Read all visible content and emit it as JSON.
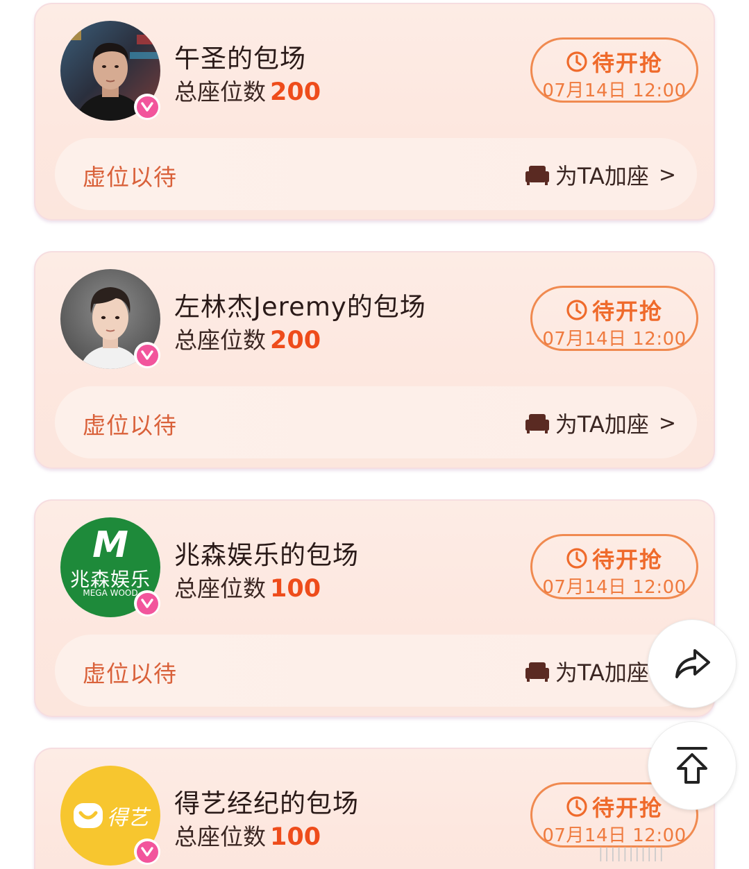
{
  "seat_label": "总座位数",
  "cards": [
    {
      "title": "午圣的包场",
      "seats": "200",
      "status": "待开抢",
      "time": "07月14日 12:00",
      "bar_text": "虚位以待",
      "add_seat": "为TA加座",
      "chevron": ">",
      "avatar_icon": "person-photo-icon"
    },
    {
      "title": "左林杰Jeremy的包场",
      "seats": "200",
      "status": "待开抢",
      "time": "07月14日 12:00",
      "bar_text": "虚位以待",
      "add_seat": "为TA加座",
      "chevron": ">",
      "avatar_icon": "person-photo-icon"
    },
    {
      "title": "兆森娱乐的包场",
      "seats": "100",
      "status": "待开抢",
      "time": "07月14日 12:00",
      "bar_text": "虚位以待",
      "add_seat": "为TA加座",
      "chevron": ">",
      "avatar_icon": "company-logo-icon",
      "logo": {
        "mark": "M",
        "name": "兆森娱乐",
        "sub": "MEGA WOOD"
      }
    },
    {
      "title": "得艺经纪的包场",
      "seats": "100",
      "status": "待开抢",
      "time": "07月14日 12:00",
      "avatar_icon": "company-logo-icon",
      "logo": {
        "name": "得艺"
      }
    }
  ],
  "floating": {
    "share_icon": "share-icon",
    "top_icon": "back-to-top-icon"
  },
  "watermark": "|||||||||||",
  "colors": {
    "accent_orange": "#ef6a2b",
    "seat_number": "#ee4c1b",
    "verify_pink": "#f2559c",
    "logo_green": "#1e8a3a",
    "logo_yellow": "#f7c62f"
  }
}
